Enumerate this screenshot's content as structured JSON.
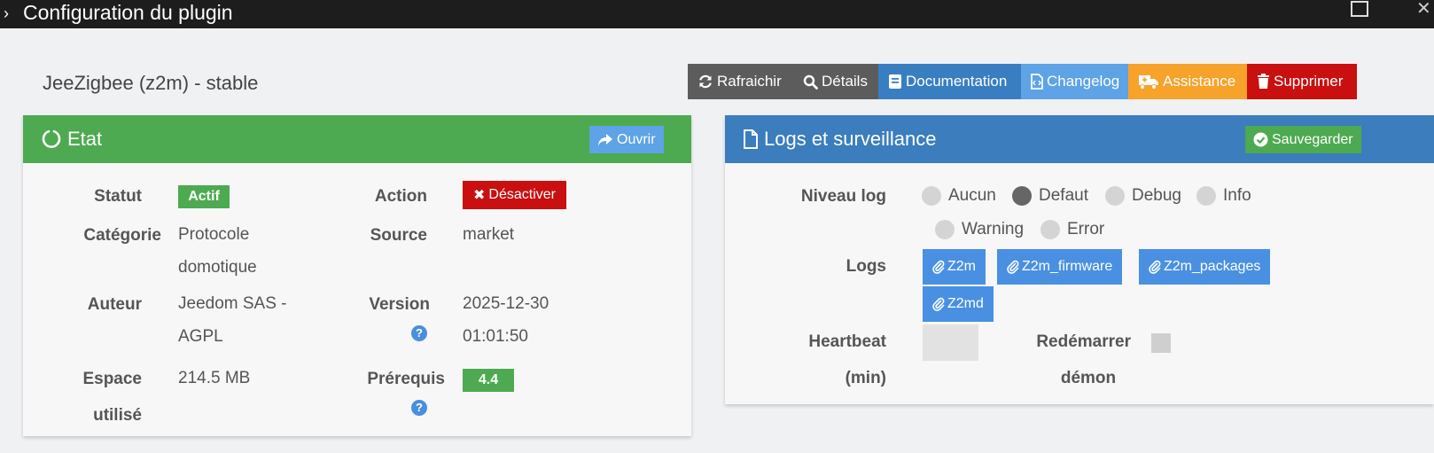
{
  "window": {
    "title": "Configuration du plugin",
    "expand_icon": "chevron-right-icon"
  },
  "plugin": {
    "name": "JeeZigbee (z2m) - stable"
  },
  "actions": [
    {
      "label": "Rafraichir",
      "icon": "refresh-icon",
      "color": "#5c5c5c"
    },
    {
      "label": "Détails",
      "icon": "search-icon",
      "color": "#5c5c5c"
    },
    {
      "label": "Documentation",
      "icon": "book-icon",
      "color": "#3a7ec2"
    },
    {
      "label": "Changelog",
      "icon": "file-code-icon",
      "color": "#5da3e6"
    },
    {
      "label": "Assistance",
      "icon": "ambulance-icon",
      "color": "#f7a22a"
    },
    {
      "label": "Supprimer",
      "icon": "trash-icon",
      "color": "#c90f0f"
    }
  ],
  "etat": {
    "title": "Etat",
    "header_color": "#4daa50",
    "open_button": "Ouvrir",
    "statut_label": "Statut",
    "statut_value": "Actif",
    "action_label": "Action",
    "action_button": "Désactiver",
    "categorie_label": "Catégorie",
    "categorie_line1": "Protocole",
    "categorie_line2": "domotique",
    "source_label": "Source",
    "source_value": "market",
    "auteur_label": "Auteur",
    "auteur_line1": "Jeedom SAS -",
    "auteur_line2": "AGPL",
    "version_label": "Version",
    "version_line1": "2025-12-30",
    "version_line2": "01:01:50",
    "espace_label_line1": "Espace",
    "espace_label_line2": "utilisé",
    "espace_value": "214.5 MB",
    "prerequis_label": "Prérequis",
    "prerequis_value": "4.4"
  },
  "logs": {
    "title": "Logs et surveillance",
    "header_color": "#3b7dbd",
    "save_button": "Sauvegarder",
    "niveau_label": "Niveau log",
    "levels": [
      {
        "label": "Aucun",
        "checked": false
      },
      {
        "label": "Defaut",
        "checked": true
      },
      {
        "label": "Debug",
        "checked": false
      },
      {
        "label": "Info",
        "checked": false
      },
      {
        "label": "Warning",
        "checked": false
      },
      {
        "label": "Error",
        "checked": false
      }
    ],
    "logs_label": "Logs",
    "log_files": [
      "Z2m",
      "Z2m_firmware",
      "Z2m_packages",
      "Z2md"
    ],
    "heartbeat_label_line1": "Heartbeat",
    "heartbeat_label_line2": "(min)",
    "heartbeat_value": "",
    "restart_label_line1": "Redémarrer",
    "restart_label_line2": "démon",
    "restart_checked": false
  }
}
